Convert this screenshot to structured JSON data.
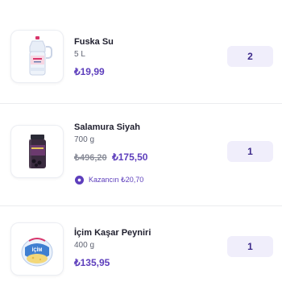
{
  "cart": {
    "items": [
      {
        "name": "Fuska Su",
        "size": "5 L",
        "price": "₺19,99",
        "quantity": "2",
        "image_icon": "water-bottle-icon"
      },
      {
        "name": "Salamura Siyah",
        "size": "700 g",
        "old_price": "₺496,20",
        "price": "₺175,50",
        "savings_label": "Kazancın ₺20,70",
        "quantity": "1",
        "image_icon": "olive-jar-icon"
      },
      {
        "name": "İçim Kaşar Peyniri",
        "size": "400 g",
        "price": "₺135,95",
        "quantity": "1",
        "image_icon": "cheese-pack-icon"
      }
    ]
  },
  "colors": {
    "accent": "#5d3ebc",
    "stepper_bg": "#f0eefb",
    "strike_price": "#8a8d99"
  }
}
